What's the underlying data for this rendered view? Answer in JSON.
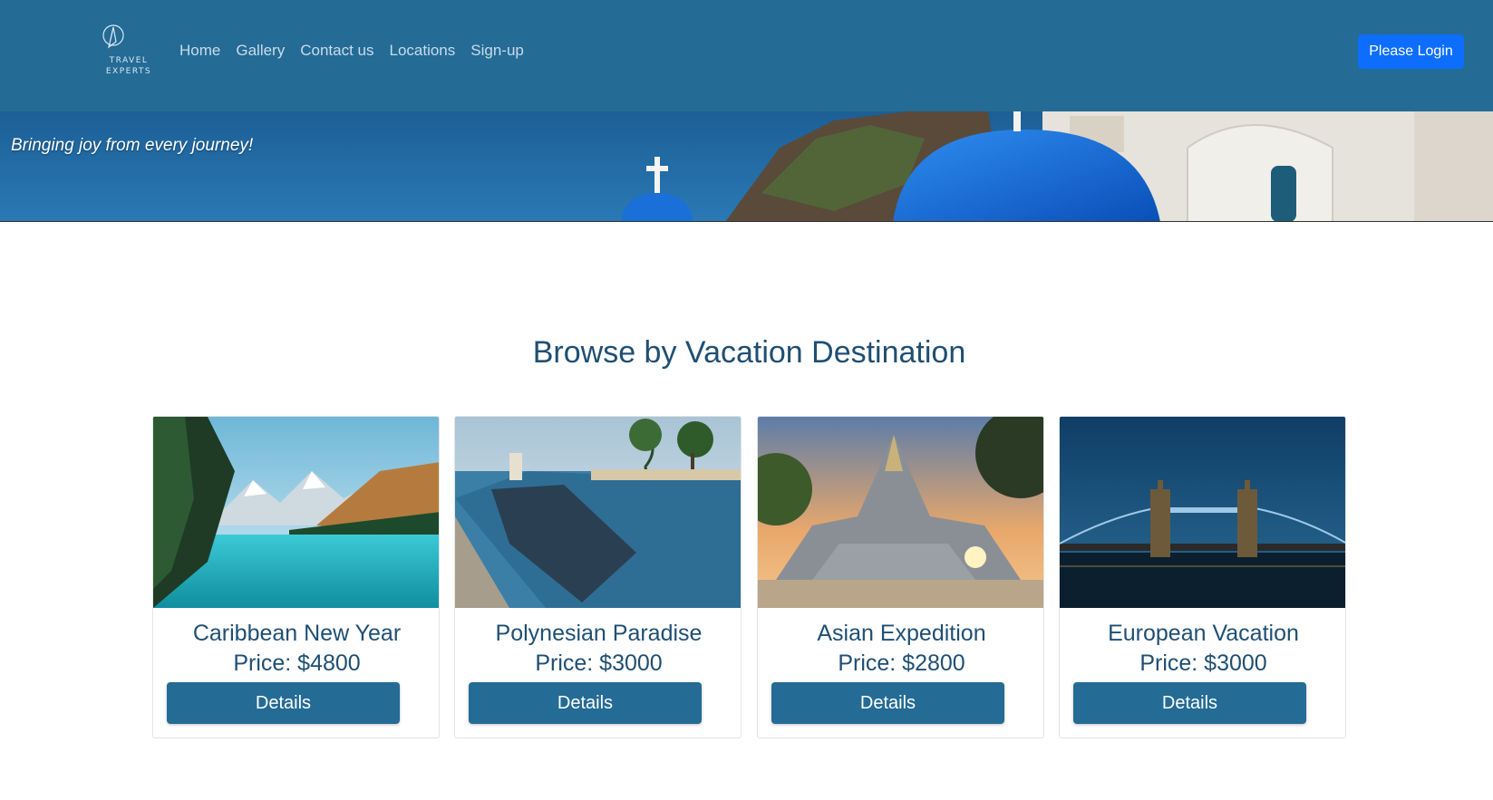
{
  "brand": {
    "line1": "TRAVEL",
    "line2": "EXPERTS",
    "logo_icon": "compass-pin-icon"
  },
  "nav": {
    "items": [
      {
        "label": "Home"
      },
      {
        "label": "Gallery"
      },
      {
        "label": "Contact us"
      },
      {
        "label": "Locations"
      },
      {
        "label": "Sign-up"
      }
    ],
    "login_label": "Please Login"
  },
  "banner": {
    "tagline": "Bringing joy from every journey!"
  },
  "section": {
    "title": "Browse by Vacation Destination"
  },
  "packages": [
    {
      "name": "Caribbean New Year",
      "price": "Price: $4800",
      "button": "Details"
    },
    {
      "name": "Polynesian Paradise",
      "price": "Price: $3000",
      "button": "Details"
    },
    {
      "name": "Asian Expedition",
      "price": "Price: $2800",
      "button": "Details"
    },
    {
      "name": "European Vacation",
      "price": "Price: $3000",
      "button": "Details"
    }
  ],
  "colors": {
    "navbar": "#246b96",
    "login_button": "#0d6efd",
    "heading": "#1f4f73",
    "details_button": "#246b96"
  }
}
